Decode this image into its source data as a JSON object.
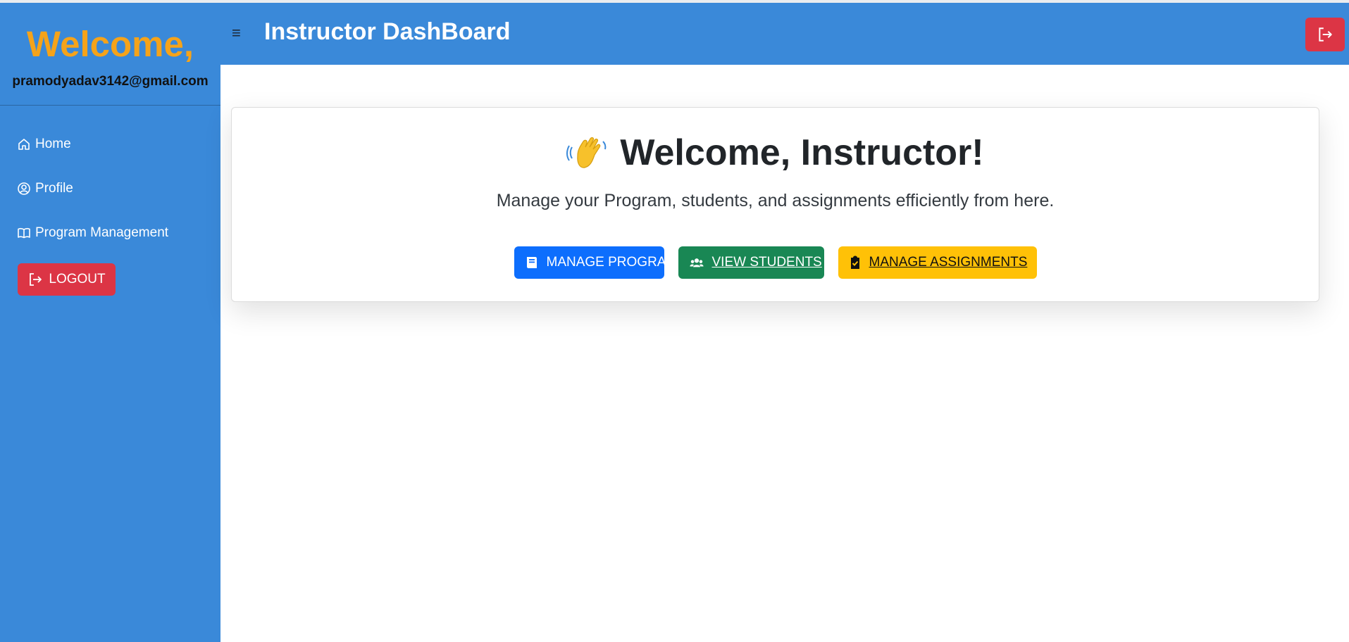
{
  "sidebar": {
    "welcome": "Welcome,",
    "email": "pramodyadav3142@gmail.com",
    "items": [
      {
        "label": "Home",
        "icon": "home-icon"
      },
      {
        "label": "Profile",
        "icon": "user-circle-icon"
      },
      {
        "label": "Program Management",
        "icon": "book-icon"
      }
    ],
    "logout_label": "LOGOUT"
  },
  "topbar": {
    "menu_icon": "≡",
    "title": "Instructor DashBoard",
    "logout_icon": "logout-icon"
  },
  "main": {
    "card_title": "Welcome, Instructor!",
    "card_emoji": "waving-hand-icon",
    "card_subtitle": "Manage your Program, students, and assignments efficiently from here.",
    "buttons": [
      {
        "label": "MANAGE PROGRAM",
        "icon": "book-icon",
        "color": "#0d6efd"
      },
      {
        "label": "VIEW STUDENTS",
        "icon": "users-icon",
        "color": "#198754"
      },
      {
        "label": "MANAGE ASSIGNMENTS",
        "icon": "clipboard-check-icon",
        "color": "#ffc107"
      }
    ]
  },
  "colors": {
    "primary_bar": "#3a89d9",
    "welcome_accent": "#f5a31a",
    "danger": "#dc3545"
  }
}
